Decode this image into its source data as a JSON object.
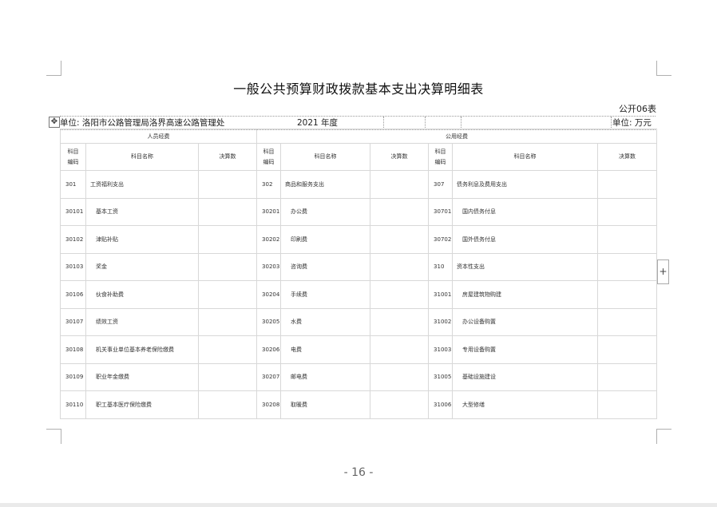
{
  "title": "一般公共预算财政拨款基本支出决算明细表",
  "doc_code": "公开06表",
  "unit_label": "单位: 洛阳市公路管理局洛界高速公路管理处",
  "year": "2021 年度",
  "currency_unit": "单位: 万元",
  "table_move_icon": "✥",
  "add_icon": "+",
  "groups": [
    "人员经费",
    "公用经费"
  ],
  "headers": {
    "code_top": "科目",
    "code_bottom": "编码",
    "name": "科目名称",
    "amount": "决算数"
  },
  "rows": [
    {
      "c1": "301",
      "n1": "工资福利支出",
      "c2": "302",
      "n2": "商品和服务支出",
      "c3": "307",
      "n3": "债务利息及费用支出"
    },
    {
      "c1": "30101",
      "n1": "基本工资",
      "c2": "30201",
      "n2": "办公费",
      "c3": "30701",
      "n3": "国内债务付息"
    },
    {
      "c1": "30102",
      "n1": "津贴补贴",
      "c2": "30202",
      "n2": "印刷费",
      "c3": "30702",
      "n3": "国外债务付息"
    },
    {
      "c1": "30103",
      "n1": "奖金",
      "c2": "30203",
      "n2": "咨询费",
      "c3": "310",
      "n3": "资本性支出"
    },
    {
      "c1": "30106",
      "n1": "伙食补助费",
      "c2": "30204",
      "n2": "手续费",
      "c3": "31001",
      "n3": "房屋建筑物购建"
    },
    {
      "c1": "30107",
      "n1": "绩效工资",
      "c2": "30205",
      "n2": "水费",
      "c3": "31002",
      "n3": "办公设备购置"
    },
    {
      "c1": "30108",
      "n1": "机关事业单位基本养老保险缴费",
      "c2": "30206",
      "n2": "电费",
      "c3": "31003",
      "n3": "专用设备购置"
    },
    {
      "c1": "30109",
      "n1": "职业年金缴费",
      "c2": "30207",
      "n2": "邮电费",
      "c3": "31005",
      "n3": "基础设施建设"
    },
    {
      "c1": "30110",
      "n1": "职工基本医疗保险缴费",
      "c2": "30208",
      "n2": "取暖费",
      "c3": "31006",
      "n3": "大型修缮"
    }
  ],
  "page_number": "- 16 -"
}
